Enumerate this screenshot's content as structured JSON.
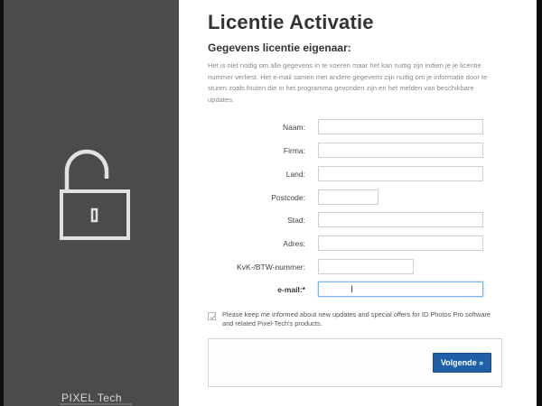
{
  "page": {
    "title": "Licentie Activatie",
    "subtitle": "Gegevens licentie eigenaar:",
    "intro": "Het is niet nodig om alle gegevens in te voeren maar het kan nuttig zijn indien je je licentie nummer verliest. Het e-mail samen met andere gegevens zijn nuttig om je informatie door te sturen zoals fouten die in het programma gevonden zijn en het melden van beschikbare updates."
  },
  "sidebar": {
    "icon": "unlocked-padlock-icon",
    "logo_text": "PIXEL Tech"
  },
  "form": {
    "fields": [
      {
        "label": "Naam:",
        "value": ""
      },
      {
        "label": "Firma:",
        "value": ""
      },
      {
        "label": "Land:",
        "value": ""
      },
      {
        "label": "Postcode:",
        "value": ""
      },
      {
        "label": "Stad:",
        "value": ""
      },
      {
        "label": "Adres:",
        "value": ""
      },
      {
        "label": "KvK-/BTW-nummer:",
        "value": ""
      },
      {
        "label": "e-mail:*",
        "value": ""
      }
    ]
  },
  "newsletter": {
    "checked": true,
    "text": "Please keep me informed about new updates and special offers for ID Photos Pro software and related Pixel-Tech's products."
  },
  "footer": {
    "next_label": "Volgende »"
  },
  "colors": {
    "sidebar": "#4b4b4b",
    "button": "#1f5fa8",
    "active_border": "#7fb0e6"
  }
}
